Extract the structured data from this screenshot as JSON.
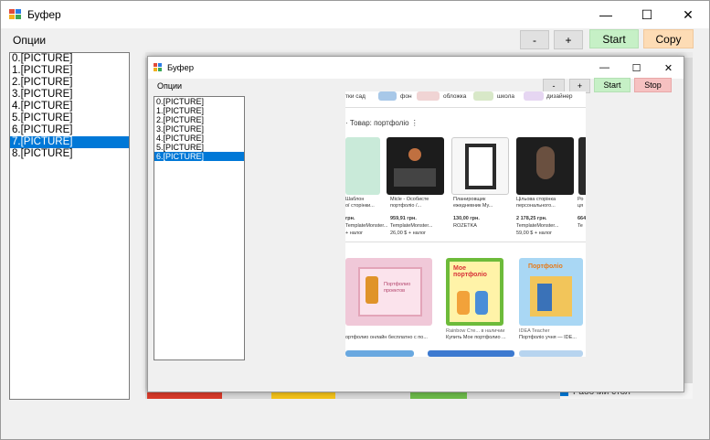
{
  "window": {
    "title": "Буфер",
    "minimize": "—",
    "maximize": "☐",
    "close": "✕"
  },
  "menu": {
    "options": "Опции"
  },
  "toolbar": {
    "minus": "-",
    "plus": "+",
    "start": "Start",
    "copy": "Copy"
  },
  "colors": {
    "start_bg": "#c6f0c6",
    "copy_bg": "#fddcb5",
    "stop_bg": "#f6c1c1",
    "selection": "#0078d7"
  },
  "list": {
    "items": [
      "0.[PICTURE]",
      "1.[PICTURE]",
      "2.[PICTURE]",
      "3.[PICTURE]",
      "4.[PICTURE]",
      "5.[PICTURE]",
      "6.[PICTURE]",
      "7.[PICTURE]",
      "8.[PICTURE]"
    ],
    "selected_index": 7
  },
  "preview": {
    "window_title": "Буфер",
    "menu_options": "Опции",
    "toolbar": {
      "minus": "-",
      "plus": "+",
      "start": "Start",
      "stop": "Stop"
    },
    "list_items": [
      "0.[PICTURE]",
      "1.[PICTURE]",
      "2.[PICTURE]",
      "3.[PICTURE]",
      "4.[PICTURE]",
      "5.[PICTURE]",
      "6.[PICTURE]"
    ],
    "selected_index": 6,
    "screenshot": {
      "chips": [
        "тки сад",
        "фон",
        "обложка",
        "школа",
        "дизайнер"
      ],
      "heading": "· Товар: портфоліо",
      "products": [
        {
          "line1": "Шаблон",
          "line2": "ої сторінки...",
          "price": "грн.",
          "shop": "TemplateMonster...",
          "extra": "+ налог"
        },
        {
          "line1": "Micle - Особисте",
          "line2": "портфоліо /...",
          "price": "959,91 грн.",
          "shop": "TemplateMonster...",
          "extra": "26,00 $ + налог"
        },
        {
          "line1": "Планировщик",
          "line2": "ежедневник Му...",
          "price": "130,00 грн.",
          "shop": "ROZETKA",
          "extra": ""
        },
        {
          "line1": "Цільова сторінка",
          "line2": "персонального...",
          "price": "2 178,25 грн.",
          "shop": "TemplateMonster...",
          "extra": "59,00 $ + налог"
        },
        {
          "line1": "Ро",
          "line2": "ця",
          "price": "664",
          "shop": "Te",
          "extra": ""
        }
      ],
      "card_texts": {
        "portfolio_card": "Портфолио проектов",
        "moe_title": "Мое портфоліо",
        "portfolio_title": "Портфоліо"
      },
      "bottom": [
        {
          "source": "",
          "caption": "ортфолио онлайн бесплатно с по..."
        },
        {
          "source": "Rainbow Сте...  в наличии",
          "caption": "Купить Мое портфолио ..."
        },
        {
          "source": "IDEA Teacher",
          "caption": "Портфоліо учня — IDE..."
        }
      ]
    }
  },
  "background_strip": {
    "desktop_label": "Рабочий стол"
  }
}
